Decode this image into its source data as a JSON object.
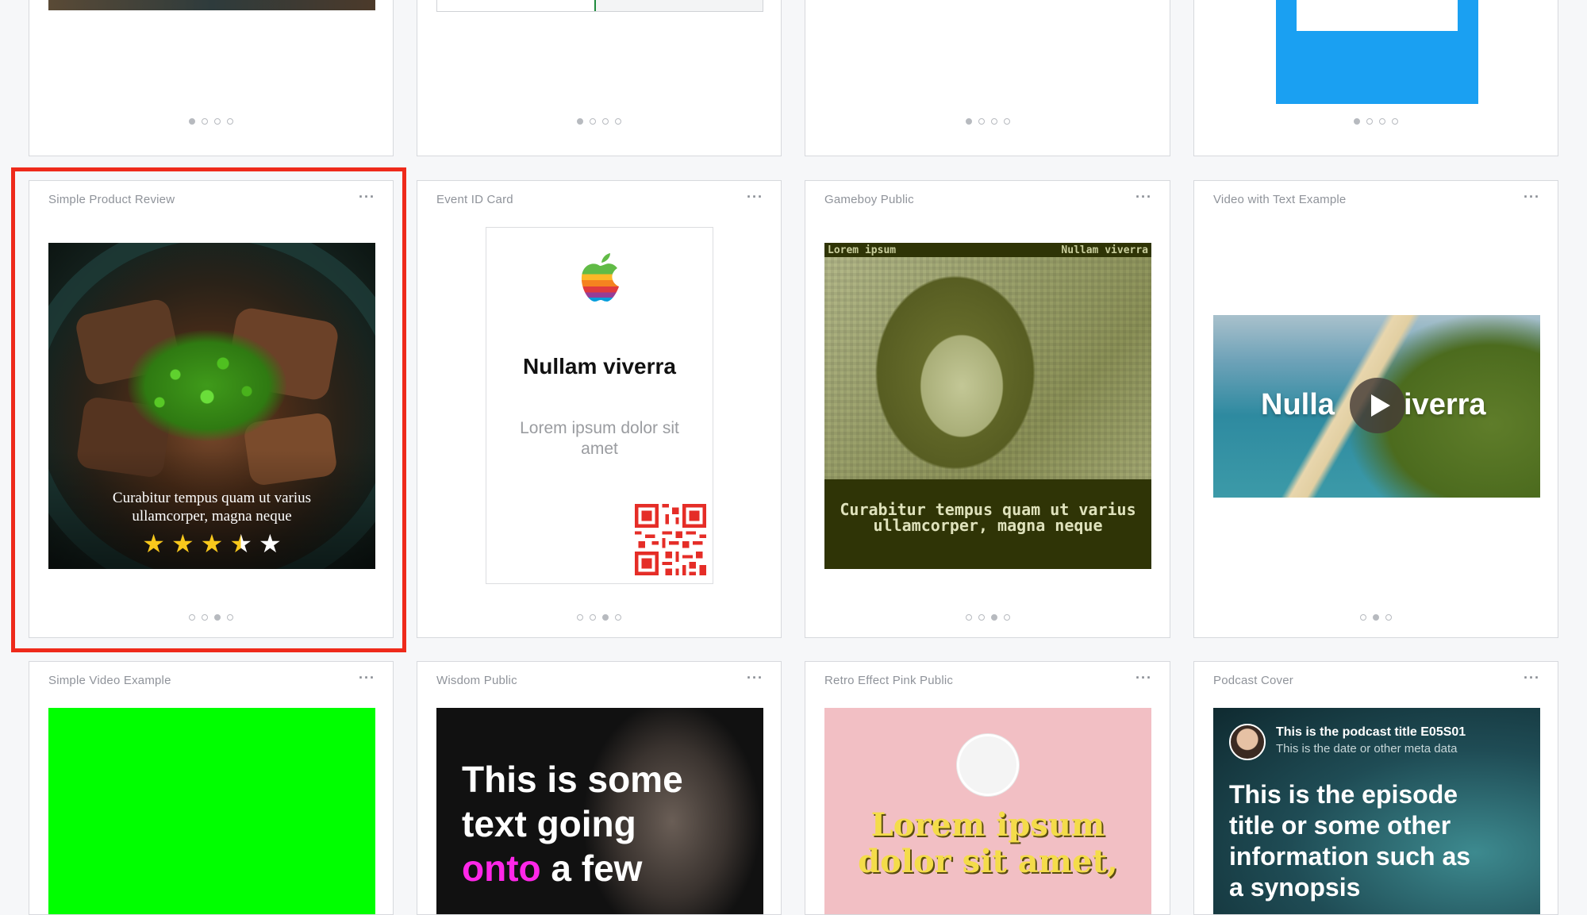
{
  "colors": {
    "highlight": "#ee2a1b",
    "gameboy_dark": "#2f3406",
    "gameboy_light": "#b4b98a",
    "green_screen": "#00ff00",
    "retro_pink": "#f2bfc4",
    "retro_yellow": "#f4dc4a",
    "blue_frame": "#1aa0f2",
    "pink_text": "#ff27e8"
  },
  "row2": [
    {
      "title": "Simple Product Review",
      "more": "···"
    },
    {
      "title": "Event ID Card",
      "more": "···"
    },
    {
      "title": "Gameboy Public",
      "more": "···"
    },
    {
      "title": "Video with Text Example",
      "more": "···"
    }
  ],
  "row3": [
    {
      "title": "Simple Video Example",
      "more": "···"
    },
    {
      "title": "Wisdom Public",
      "more": "···"
    },
    {
      "title": "Retro Effect Pink Public",
      "more": "···"
    },
    {
      "title": "Podcast Cover",
      "more": "···"
    }
  ],
  "product_review": {
    "caption": "Curabitur tempus quam ut varius ullamcorper, magna neque",
    "rating": 3.5,
    "rating_max": 5
  },
  "event_card": {
    "name": "Nullam viverra",
    "subtitle": "Lorem ipsum dolor sit amet"
  },
  "gameboy": {
    "top_left": "Lorem ipsum",
    "top_right": "Nullam viverra",
    "caption": "Curabitur tempus quam ut varius ullamcorper, magna neque"
  },
  "video_text": {
    "overlay_left": "Nulla",
    "overlay_right": "iverra"
  },
  "wisdom": {
    "line1": "This is some",
    "line2": "text going",
    "line3_highlight": "onto",
    "line3_rest": " a few"
  },
  "retro": {
    "line1": "Lorem ipsum",
    "line2": "dolor sit amet,"
  },
  "podcast": {
    "title": "This is the podcast title E05S01",
    "meta": "This is the date or other meta data",
    "episode_line1": "This is the episode",
    "episode_line2": "title or some other",
    "episode_line3": "information such as",
    "episode_line4": "a synopsis"
  }
}
